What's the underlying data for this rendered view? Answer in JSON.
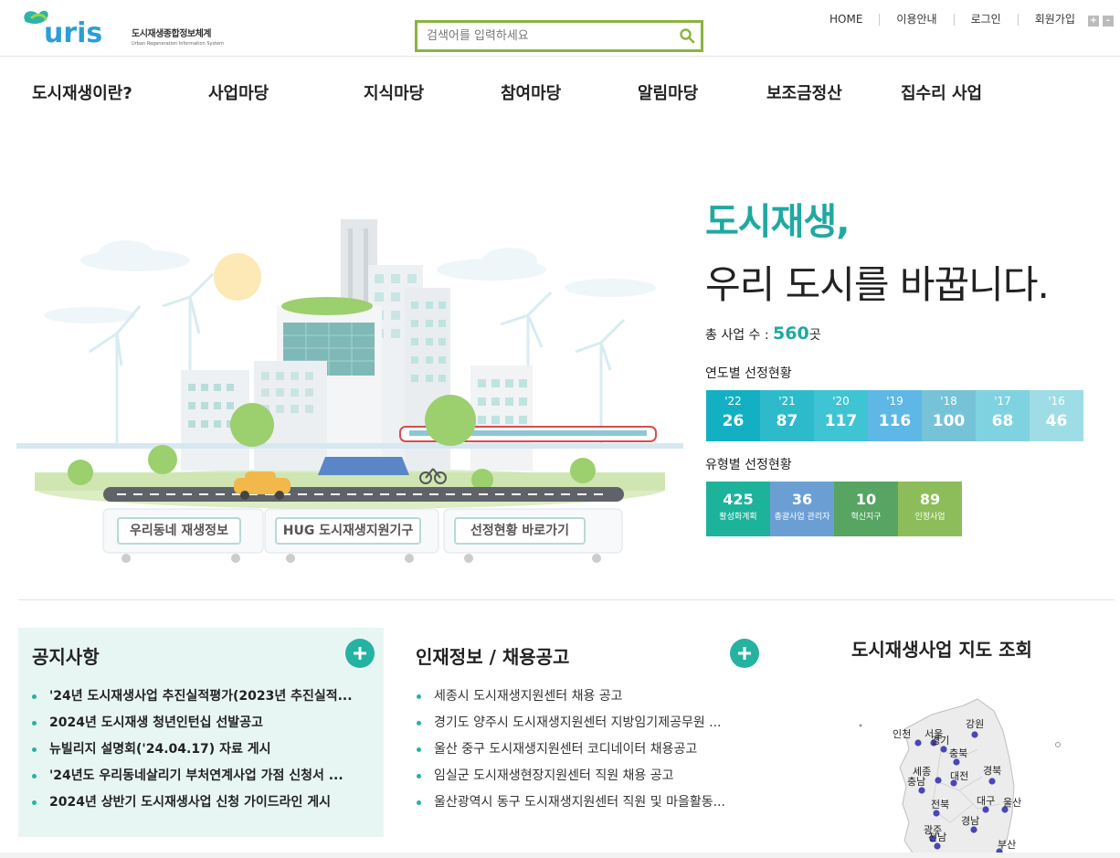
{
  "header": {
    "logo_mark": "uris",
    "logo_title": "도시재생종합정보체계",
    "logo_subtitle": "Urban Regeneration Information System",
    "search_placeholder": "검색어를 입력하세요",
    "util_links": [
      "HOME",
      "이용안내",
      "로그인",
      "회원가입"
    ],
    "zoom_in": "+",
    "zoom_out": "-"
  },
  "nav": [
    "도시재생이란?",
    "사업마당",
    "지식마당",
    "참여마당",
    "알림마당",
    "보조금정산",
    "집수리 사업"
  ],
  "hero": {
    "buttons": [
      "우리동네 재생정보",
      "HUG 도시재생지원기구",
      "선정현황 바로가기"
    ]
  },
  "summary": {
    "headline1": "도시재생,",
    "headline2": "우리 도시를 바꿉니다.",
    "total_label": "총 사업 수 :",
    "total_value": "560",
    "total_unit": "곳",
    "yearly_title": "연도별 선정현황",
    "yearly": [
      {
        "year": "'22",
        "value": "26",
        "color": "#13b0c3"
      },
      {
        "year": "'21",
        "value": "87",
        "color": "#2dbbcb"
      },
      {
        "year": "'20",
        "value": "117",
        "color": "#3ec4d3"
      },
      {
        "year": "'19",
        "value": "116",
        "color": "#5db8e6"
      },
      {
        "year": "'18",
        "value": "100",
        "color": "#76c3d8"
      },
      {
        "year": "'17",
        "value": "68",
        "color": "#7fd3e0"
      },
      {
        "year": "'16",
        "value": "46",
        "color": "#9fdde6"
      }
    ],
    "type_title": "유형별 선정현황",
    "types": [
      {
        "value": "425",
        "label": "활성화계획",
        "color": "#1db39b"
      },
      {
        "value": "36",
        "label": "총괄사업 관리자",
        "color": "#6b9fd4"
      },
      {
        "value": "10",
        "label": "혁신지구",
        "color": "#58a463"
      },
      {
        "value": "89",
        "label": "인정사업",
        "color": "#8cbd5a"
      }
    ]
  },
  "notice": {
    "title": "공지사항",
    "items": [
      "'24년 도시재생사업 추진실적평가(2023년 추진실적...",
      "2024년 도시재생 청년인턴십 선발공고",
      "뉴빌리지 설명회('24.04.17) 자료 게시",
      "'24년도 우리동네살리기 부처연계사업 가점 신청서 ...",
      "2024년 상반기 도시재생사업 신청 가이드라인 게시"
    ]
  },
  "recruit": {
    "title": "인재정보 / 채용공고",
    "items": [
      "세종시 도시재생지원센터 채용 공고",
      "경기도 양주시 도시재생지원센터 지방임기제공무원 ...",
      "울산 중구 도시재생지원센터 코디네이터 채용공고",
      "임실군 도시재생현장지원센터 직원 채용 공고",
      "울산광역시 동구 도시재생지원센터 직원 및 마을활동..."
    ]
  },
  "map": {
    "title": "도시재생사업 지도 조회",
    "regions": [
      "인천",
      "서울",
      "강원",
      "경기",
      "충북",
      "세종",
      "충남",
      "대전",
      "경북",
      "대구",
      "전북",
      "울산",
      "경남",
      "광주",
      "부산",
      "전남"
    ]
  },
  "colors": {
    "accent": "#1fa9a0",
    "search_border": "#8cb33f",
    "notice_bg": "#e8f6f3"
  }
}
